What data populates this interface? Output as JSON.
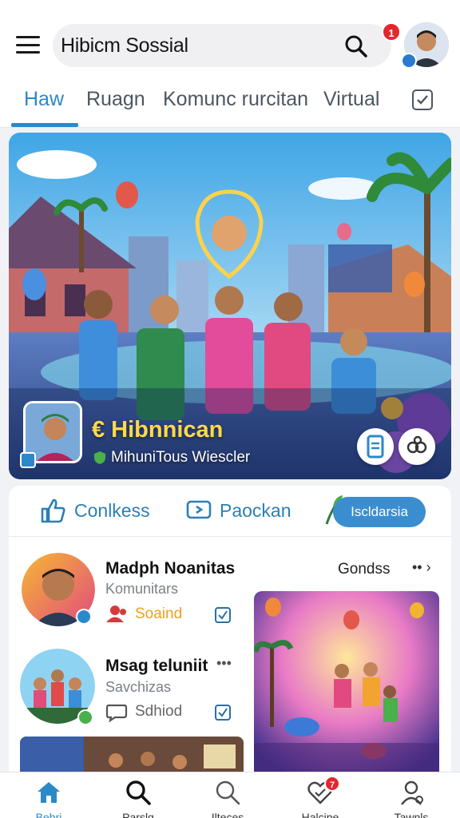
{
  "header": {
    "search_title": "Hibicm Sossial",
    "notification_count": "1"
  },
  "tabs": [
    {
      "label": "Haw",
      "active": true
    },
    {
      "label": "Ruagn"
    },
    {
      "label": "Komunc rurcitan"
    },
    {
      "label": "Virtual"
    }
  ],
  "hero": {
    "title": "€ Hibnnican",
    "subtitle": "MihuniTous Wiescler"
  },
  "actions": {
    "like_label": "Conlkess",
    "share_label": "Paockan",
    "pill_label": "Iscldarsia"
  },
  "posts": [
    {
      "name": "Madph Noanitas",
      "sub": "Komunitars",
      "tag": "Soaind",
      "right_label": "Gondss"
    },
    {
      "name": "Msag teluniit",
      "sub": "Savchizas",
      "tag": "Sdhiod"
    }
  ],
  "bottom_nav": [
    {
      "label": "Bebri",
      "icon": "home-icon",
      "active": true
    },
    {
      "label": "Parslq",
      "icon": "search-icon"
    },
    {
      "label": "Ilteces",
      "icon": "search-icon"
    },
    {
      "label": "Halcipe",
      "icon": "heart-icon",
      "badge": "7"
    },
    {
      "label": "Tawnls",
      "icon": "profile-icon"
    }
  ],
  "colors": {
    "accent": "#2b89c8",
    "badge": "#e5262f",
    "hero_title": "#ffd94a"
  }
}
